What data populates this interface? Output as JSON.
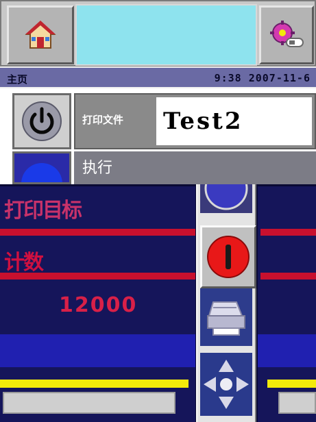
{
  "header": {
    "breadcrumb": "主页",
    "datetime": "9:38 2007-11-6"
  },
  "job": {
    "file_label": "打印文件",
    "file_name": "Test2",
    "exec_label": "执行"
  },
  "readouts": {
    "left_row1": "打印目标",
    "left_row2": "计数",
    "left_row3": "12000"
  },
  "colors": {
    "status_bar": "#6a6aa4",
    "banner": "#8ee3ee",
    "stop_button": "#e81818",
    "background": "#0a0a34"
  },
  "icons": {
    "home": "home-icon",
    "settings": "settings-gear-icon",
    "power": "power-icon",
    "stop": "stop-icon",
    "print": "printer-icon",
    "nav": "direction-arrows-icon"
  }
}
